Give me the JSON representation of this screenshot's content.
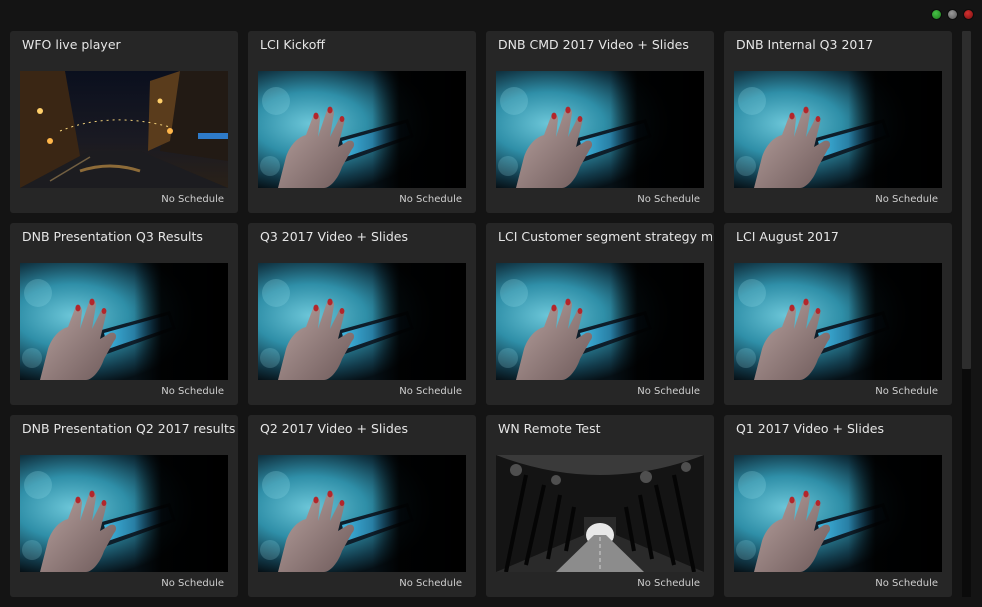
{
  "window": {
    "controls": [
      "maximize",
      "minimize",
      "close"
    ],
    "colors": {
      "maximize": "#2ea52e",
      "minimize": "#777777",
      "close": "#a51e1e"
    }
  },
  "players": [
    {
      "title": "WFO live player",
      "status": "No Schedule",
      "thumbnail": "night-street"
    },
    {
      "title": "LCI Kickoff",
      "status": "No Schedule",
      "thumbnail": "hand-phone"
    },
    {
      "title": "DNB CMD  2017 Video + Slides",
      "status": "No Schedule",
      "thumbnail": "hand-phone"
    },
    {
      "title": "DNB Internal Q3 2017",
      "status": "No Schedule",
      "thumbnail": "hand-phone"
    },
    {
      "title": "DNB Presentation Q3 Results",
      "status": "No Schedule",
      "thumbnail": "hand-phone"
    },
    {
      "title": "Q3 2017 Video + Slides",
      "status": "No Schedule",
      "thumbnail": "hand-phone"
    },
    {
      "title": "LCI  Customer segment strategy meeting",
      "status": "No Schedule",
      "thumbnail": "hand-phone"
    },
    {
      "title": "LCI August 2017",
      "status": "No Schedule",
      "thumbnail": "hand-phone"
    },
    {
      "title": "DNB Presentation Q2 2017 results",
      "status": "No Schedule",
      "thumbnail": "hand-phone"
    },
    {
      "title": "Q2 2017 Video + Slides",
      "status": "No Schedule",
      "thumbnail": "hand-phone"
    },
    {
      "title": "WN Remote Test",
      "status": "No Schedule",
      "thumbnail": "tree-tunnel"
    },
    {
      "title": "Q1 2017 Video + Slides",
      "status": "No Schedule",
      "thumbnail": "hand-phone"
    }
  ]
}
